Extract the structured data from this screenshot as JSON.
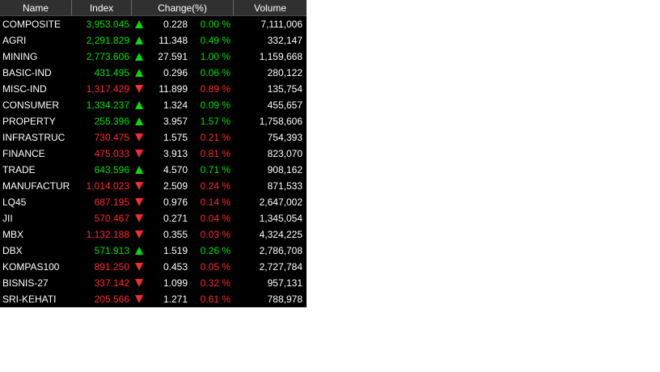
{
  "columns": {
    "name": "Name",
    "index": "Index",
    "change": "Change(%)",
    "volume": "Volume"
  },
  "colors": {
    "up": "#00e000",
    "down": "#ff2a2a",
    "header_bg": "#303030",
    "row_bg": "#000000"
  },
  "rows": [
    {
      "name": "COMPOSITE",
      "index": "3,953.045",
      "dir": "up",
      "change": "0.228",
      "pct": "0.00 %",
      "volume": "7,111,006"
    },
    {
      "name": "AGRI",
      "index": "2,291.829",
      "dir": "up",
      "change": "11.348",
      "pct": "0.49 %",
      "volume": "332,147"
    },
    {
      "name": "MINING",
      "index": "2,773.606",
      "dir": "up",
      "change": "27.591",
      "pct": "1.00 %",
      "volume": "1,159,668"
    },
    {
      "name": "BASIC-IND",
      "index": "431.495",
      "dir": "up",
      "change": "0.296",
      "pct": "0.06 %",
      "volume": "280,122"
    },
    {
      "name": "MISC-IND",
      "index": "1,317.429",
      "dir": "down",
      "change": "11.899",
      "pct": "0.89 %",
      "volume": "135,754"
    },
    {
      "name": "CONSUMER",
      "index": "1,334.237",
      "dir": "up",
      "change": "1.324",
      "pct": "0.09 %",
      "volume": "455,657"
    },
    {
      "name": "PROPERTY",
      "index": "255.396",
      "dir": "up",
      "change": "3.957",
      "pct": "1.57 %",
      "volume": "1,758,606"
    },
    {
      "name": "INFRASTRUC",
      "index": "730.475",
      "dir": "down",
      "change": "1.575",
      "pct": "0.21 %",
      "volume": "754,393"
    },
    {
      "name": "FINANCE",
      "index": "475.033",
      "dir": "down",
      "change": "3.913",
      "pct": "0.81 %",
      "volume": "823,070"
    },
    {
      "name": "TRADE",
      "index": "643.596",
      "dir": "up",
      "change": "4.570",
      "pct": "0.71 %",
      "volume": "908,162"
    },
    {
      "name": "MANUFACTUR",
      "index": "1,014.023",
      "dir": "down",
      "change": "2.509",
      "pct": "0.24 %",
      "volume": "871,533"
    },
    {
      "name": "LQ45",
      "index": "687.195",
      "dir": "down",
      "change": "0.976",
      "pct": "0.14 %",
      "volume": "2,647,002"
    },
    {
      "name": "JII",
      "index": "570.467",
      "dir": "down",
      "change": "0.271",
      "pct": "0.04 %",
      "volume": "1,345,054"
    },
    {
      "name": "MBX",
      "index": "1,132.188",
      "dir": "down",
      "change": "0.355",
      "pct": "0.03 %",
      "volume": "4,324,225"
    },
    {
      "name": "DBX",
      "index": "571.913",
      "dir": "up",
      "change": "1.519",
      "pct": "0.26 %",
      "volume": "2,786,708"
    },
    {
      "name": "KOMPAS100",
      "index": "891.250",
      "dir": "down",
      "change": "0.453",
      "pct": "0.05 %",
      "volume": "2,727,784"
    },
    {
      "name": "BISNIS-27",
      "index": "337.142",
      "dir": "down",
      "change": "1.099",
      "pct": "0.32 %",
      "volume": "957,131"
    },
    {
      "name": "SRI-KEHATI",
      "index": "205.566",
      "dir": "down",
      "change": "1.271",
      "pct": "0.61 %",
      "volume": "788,978"
    }
  ]
}
